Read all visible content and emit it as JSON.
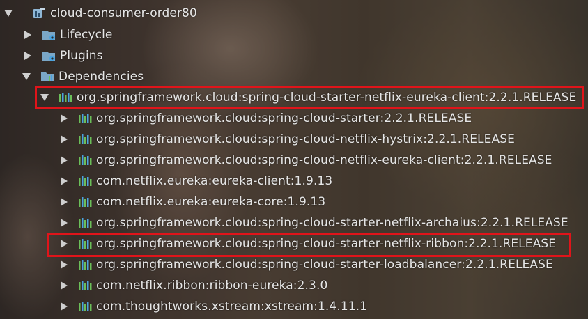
{
  "project_tree": {
    "root": {
      "label": "cloud-consumer-order80",
      "expanded": true
    },
    "lifecycle": {
      "label": "Lifecycle",
      "expanded": false
    },
    "plugins": {
      "label": "Plugins",
      "expanded": false
    },
    "dependencies": {
      "label": "Dependencies",
      "expanded": true,
      "items": [
        {
          "label": "org.springframework.cloud:spring-cloud-starter-netflix-eureka-client:2.2.1.RELEASE",
          "expanded": true,
          "highlighted": true
        },
        {
          "label": "org.springframework.cloud:spring-cloud-starter:2.2.1.RELEASE",
          "expanded": false
        },
        {
          "label": "org.springframework.cloud:spring-cloud-netflix-hystrix:2.2.1.RELEASE",
          "expanded": false
        },
        {
          "label": "org.springframework.cloud:spring-cloud-netflix-eureka-client:2.2.1.RELEASE",
          "expanded": false
        },
        {
          "label": "com.netflix.eureka:eureka-client:1.9.13",
          "expanded": false
        },
        {
          "label": "com.netflix.eureka:eureka-core:1.9.13",
          "expanded": false
        },
        {
          "label": "org.springframework.cloud:spring-cloud-starter-netflix-archaius:2.2.1.RELEASE",
          "expanded": false
        },
        {
          "label": "org.springframework.cloud:spring-cloud-starter-netflix-ribbon:2.2.1.RELEASE",
          "expanded": false,
          "highlighted": true
        },
        {
          "label": "org.springframework.cloud:spring-cloud-starter-loadbalancer:2.2.1.RELEASE",
          "expanded": false
        },
        {
          "label": "com.netflix.ribbon:ribbon-eureka:2.3.0",
          "expanded": false
        },
        {
          "label": "com.thoughtworks.xstream:xstream:1.4.11.1",
          "expanded": false
        }
      ]
    }
  },
  "icons": {
    "module": "maven-module-icon",
    "lifecycle": "lifecycle-folder-gear-icon",
    "plugins": "plugins-folder-gear-icon",
    "dependencies": "dependencies-folder-icon",
    "library": "library-bars-icon"
  },
  "colors": {
    "text": "#e6e6e6",
    "highlight_border": "#e0141a",
    "folder_blue": "#7aa7c7",
    "lib_green": "#6bbf59",
    "lib_blue": "#4aa3df"
  }
}
